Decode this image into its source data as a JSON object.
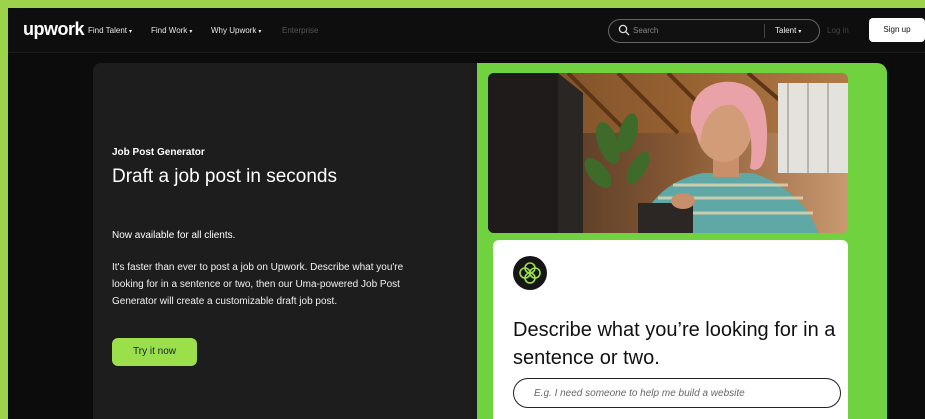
{
  "nav": {
    "logo": "upwork",
    "links": [
      {
        "label": "Find Talent"
      },
      {
        "label": "Find Work"
      },
      {
        "label": "Why Upwork"
      }
    ],
    "enterprise": "Enterprise",
    "search_placeholder": "Search",
    "search_scope": "Talent",
    "login": "Log in",
    "signup": "Sign up"
  },
  "hero": {
    "eyebrow": "Job Post Generator",
    "headline": "Draft a job post in seconds",
    "subheadline": "Now available for all clients.",
    "body": "It's faster than ever to post a job on Upwork. Describe what you're looking for in a sentence or two, then our Uma-powered Job Post Generator will create a customizable draft job post.",
    "cta": "Try it now"
  },
  "card": {
    "title": "Describe what you’re looking for in a sentence or two.",
    "input_placeholder": "E.g. I need someone to help me build a website"
  },
  "colors": {
    "accent_green": "#6fd23e",
    "button_green": "#9be04b",
    "page_bg": "#9bd44a",
    "dark_panel": "#1d1d1d"
  },
  "icons": {
    "search": "search-icon",
    "chevron": "chevron-down-icon",
    "uma": "uma-logo-icon"
  }
}
